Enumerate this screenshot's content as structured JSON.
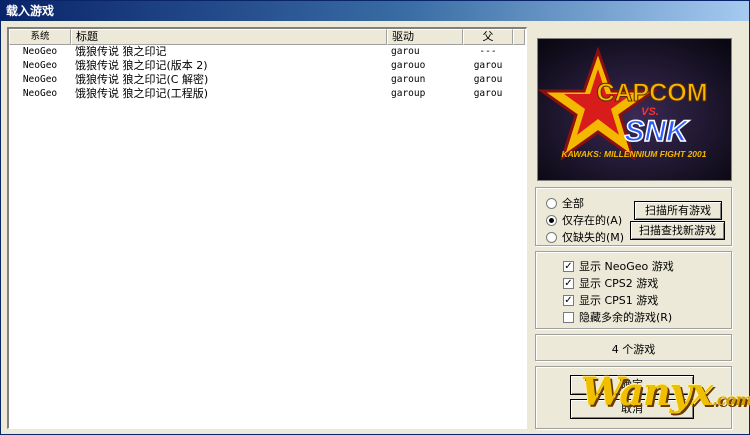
{
  "window": {
    "title": "载入游戏"
  },
  "list": {
    "columns": [
      "系统",
      "标题",
      "驱动",
      "父"
    ],
    "rows": [
      {
        "system": "NeoGeo",
        "title": "饿狼传说 狼之印记",
        "driver": "garou",
        "parent": "---"
      },
      {
        "system": "NeoGeo",
        "title": "饿狼传说 狼之印记(版本 2)",
        "driver": "garouo",
        "parent": "garou"
      },
      {
        "system": "NeoGeo",
        "title": "饿狼传说 狼之印记(C 解密)",
        "driver": "garoun",
        "parent": "garou"
      },
      {
        "system": "NeoGeo",
        "title": "饿狼传说 狼之印记(工程版)",
        "driver": "garoup",
        "parent": "garou"
      }
    ]
  },
  "preview": {
    "logo_top": "CAPCOM",
    "logo_vs": "VS.",
    "logo_bottom": "SNK",
    "logo_subtitle": "KAWAKS: MILLENNIUM FIGHT 2001"
  },
  "filter": {
    "options": [
      {
        "label": "全部",
        "selected": false
      },
      {
        "label": "仅存在的(A)",
        "selected": true
      },
      {
        "label": "仅缺失的(M)",
        "selected": false
      }
    ],
    "scan_all_label": "扫描所有游戏",
    "scan_new_label": "扫描查找新游戏"
  },
  "systems": {
    "items": [
      {
        "label": "显示 NeoGeo 游戏",
        "checked": true
      },
      {
        "label": "显示 CPS2 游戏",
        "checked": true
      },
      {
        "label": "显示 CPS1 游戏",
        "checked": true
      },
      {
        "label": "隐藏多余的游戏(R)",
        "checked": false
      }
    ]
  },
  "status": {
    "count_text": "4 个游戏"
  },
  "buttons": {
    "ok_label": "确定",
    "cancel_label": "取消"
  },
  "watermark": {
    "text": "Wanyx",
    "suffix": ".com"
  },
  "colors": {
    "titlebar": "#0a246a",
    "window_bg": "#ece9d8",
    "logo_gold": "#f5b800",
    "logo_red": "#d81c1c",
    "logo_blue": "#1a3fd0"
  }
}
